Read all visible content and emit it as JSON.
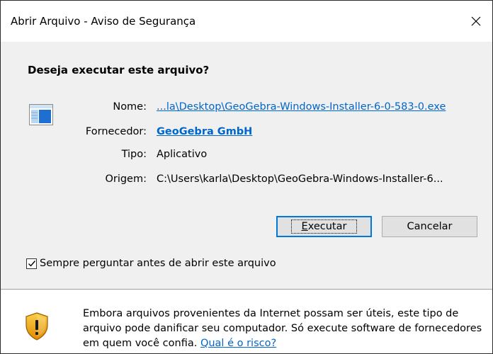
{
  "window": {
    "title": "Abrir Arquivo - Aviso de Segurança",
    "close_label": "✕"
  },
  "dialog": {
    "heading": "Deseja executar este arquivo?",
    "fields": {
      "name_label": "Nome:",
      "name_value": "...la\\Desktop\\GeoGebra-Windows-Installer-6-0-583-0.exe",
      "vendor_label": "Fornecedor:",
      "vendor_value": "GeoGebra GmbH",
      "type_label": "Tipo:",
      "type_value": "Aplicativo",
      "origin_label": "Origem:",
      "origin_value": "C:\\Users\\karla\\Desktop\\GeoGebra-Windows-Installer-6..."
    },
    "buttons": {
      "run_accel": "E",
      "run_rest": "xecutar",
      "cancel": "Cancelar"
    },
    "checkbox": {
      "label": "Sempre perguntar antes de abrir este arquivo",
      "checked": true
    }
  },
  "warning": {
    "text": "Embora arquivos provenientes da Internet possam ser úteis, este tipo de arquivo pode danificar seu computador. Só execute software de fornecedores em quem você confia.",
    "link": "Qual é o risco?"
  },
  "icons": {
    "file": "application-window-icon",
    "shield": "security-shield-warning-icon",
    "close": "close-icon",
    "check": "checkmark-icon"
  },
  "colors": {
    "link": "#0066cc",
    "accent": "#0078d7",
    "dialog_bg": "#f0f0f0",
    "shield_gold": "#e8a317"
  }
}
